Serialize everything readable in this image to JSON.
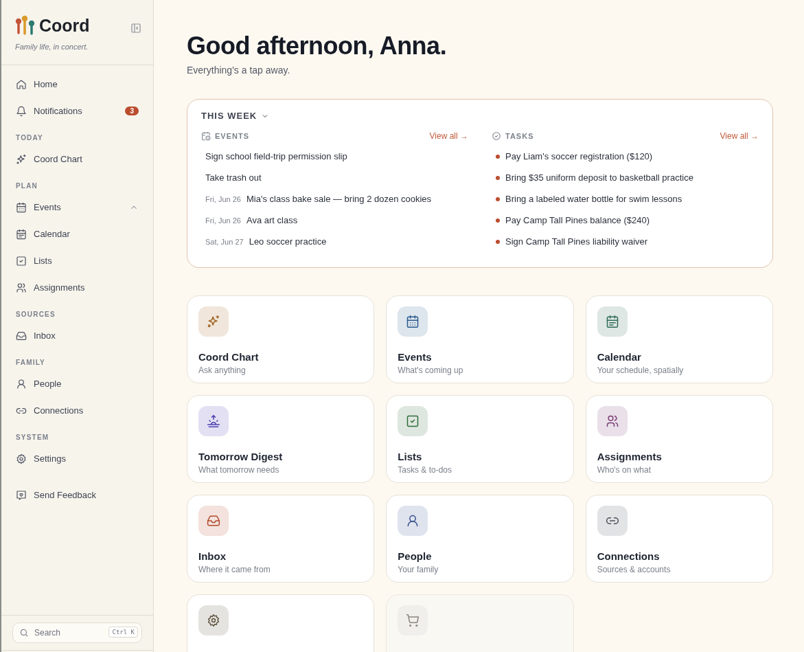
{
  "sidebar": {
    "brand": "Coord",
    "tagline": "Family life, in concert.",
    "sections": [
      {
        "items": [
          {
            "label": "Home",
            "expanded": false
          },
          {
            "label": "Notifications",
            "badge": "3",
            "expanded": false
          }
        ]
      },
      {
        "heading": "TODAY",
        "items": [
          {
            "label": "Coord Chart",
            "expanded": false
          }
        ]
      },
      {
        "heading": "PLAN",
        "items": [
          {
            "label": "Events",
            "expanded": true
          },
          {
            "label": "Calendar",
            "expanded": false
          },
          {
            "label": "Lists",
            "expanded": false
          },
          {
            "label": "Assignments",
            "expanded": false
          }
        ]
      },
      {
        "heading": "SOURCES",
        "items": [
          {
            "label": "Inbox",
            "expanded": false
          }
        ]
      },
      {
        "heading": "FAMILY",
        "items": [
          {
            "label": "People",
            "expanded": false
          },
          {
            "label": "Connections",
            "expanded": false
          }
        ]
      },
      {
        "heading": "SYSTEM",
        "items": [
          {
            "label": "Settings",
            "expanded": false
          }
        ]
      }
    ],
    "feedback": "Send Feedback",
    "search": {
      "placeholder": "Search",
      "shortcut": "Ctrl K"
    }
  },
  "greeting": {
    "title": "Good afternoon, Anna.",
    "subtitle": "Everything's a tap away."
  },
  "this_week": {
    "title": "THIS WEEK",
    "events": {
      "heading": "EVENTS",
      "link": "View all →",
      "items": [
        {
          "text": "Sign school field-trip permission slip"
        },
        {
          "text": "Take trash out"
        },
        {
          "date": "Fri, Jun 26",
          "text": "Mia's class bake sale — bring 2 dozen cookies"
        },
        {
          "date": "Fri, Jun 26",
          "text": "Ava art class"
        },
        {
          "date": "Sat, Jun 27",
          "text": "Leo soccer practice"
        }
      ]
    },
    "tasks": {
      "heading": "TASKS",
      "link": "View all →",
      "items": [
        "Pay Liam's soccer registration ($120)",
        "Bring $35 uniform deposit to basketball practice",
        "Bring a labeled water bottle for swim lessons",
        "Pay Camp Tall Pines balance ($240)",
        "Sign Camp Tall Pines liability waiver"
      ]
    }
  },
  "cards": [
    {
      "title": "Coord Chart",
      "subtitle": "Ask anything",
      "color": "#a0601c",
      "disabled": false
    },
    {
      "title": "Events",
      "subtitle": "What's coming up",
      "color": "#2a5a8c",
      "disabled": false
    },
    {
      "title": "Calendar",
      "subtitle": "Your schedule, spatially",
      "color": "#2f6b55",
      "disabled": false
    },
    {
      "title": "Tomorrow Digest",
      "subtitle": "What tomorrow needs",
      "color": "#4b3fb0",
      "disabled": false
    },
    {
      "title": "Lists",
      "subtitle": "Tasks & to-dos",
      "color": "#2f6b3a",
      "disabled": false
    },
    {
      "title": "Assignments",
      "subtitle": "Who's on what",
      "color": "#7a3d78",
      "disabled": false
    },
    {
      "title": "Inbox",
      "subtitle": "Where it came from",
      "color": "#b24a2c",
      "disabled": false
    },
    {
      "title": "People",
      "subtitle": "Your family",
      "color": "#3a4f8f",
      "disabled": false
    },
    {
      "title": "Connections",
      "subtitle": "Sources & accounts",
      "color": "#4a4f5a",
      "disabled": false
    },
    {
      "color": "#5e5340",
      "disabled": false
    },
    {
      "color": "#8a8580",
      "disabled": true
    }
  ]
}
